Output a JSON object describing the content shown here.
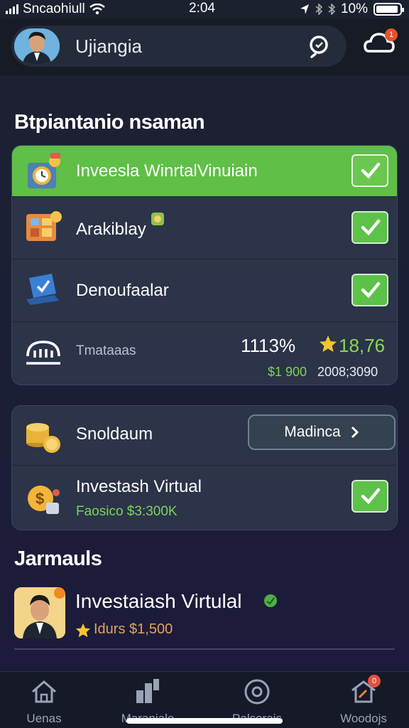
{
  "status_bar": {
    "carrier": "Sncaohiull",
    "time": "2:04",
    "battery": "10%"
  },
  "header": {
    "user_name": "Ujiangia",
    "notification_count": "1"
  },
  "section_main": {
    "title": "Btpiantanio nsaman"
  },
  "tasks": [
    {
      "label": "Inveesla WinrtalVinuiain",
      "checked": true,
      "highlight": true
    },
    {
      "label": "Arakiblay",
      "checked": true,
      "highlight": false
    },
    {
      "label": "Denoufaalar",
      "checked": true,
      "highlight": false
    }
  ],
  "stats": {
    "label": "Tmataaas",
    "percent": "1113%",
    "star_value": "18,76",
    "amount_green": "$1 900",
    "amount_white": "2008;3090"
  },
  "savings": {
    "label": "Snoldaum",
    "button_label": "Madinca",
    "item_title": "Investash Virtual",
    "item_subtitle": "Faosico $3:300K"
  },
  "section_journals": {
    "title": "Jarmauls"
  },
  "profile": {
    "name": "Investaiash Virtulal",
    "meta": "Idurs  $1,500"
  },
  "tabs": [
    {
      "label": "Uenas"
    },
    {
      "label": "Maraniale"
    },
    {
      "label": "Palsorais"
    },
    {
      "label": "Woodojs",
      "badge": "0"
    }
  ],
  "colors": {
    "accent_green": "#5fbf46",
    "star": "#f2c434",
    "background": "#1c2033"
  }
}
